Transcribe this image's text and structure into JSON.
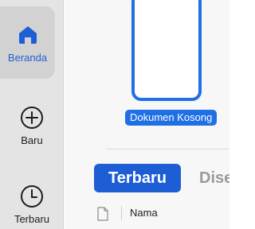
{
  "sidebar": {
    "items": [
      {
        "label": "Beranda",
        "icon": "home-icon",
        "active": true
      },
      {
        "label": "Baru",
        "icon": "plus-circle-icon",
        "active": false
      },
      {
        "label": "Terbaru",
        "icon": "clock-icon",
        "active": false
      }
    ]
  },
  "templates": {
    "blank_document_label": "Dokumen Kosong"
  },
  "tabs": {
    "active_label": "Terbaru",
    "inactive_label": "Dise"
  },
  "file_list": {
    "columns": [
      "Nama"
    ]
  },
  "colors": {
    "accent": "#1f6fe5",
    "sidebar_bg": "#e4e4e4",
    "active_item_bg": "#d2d2d2"
  }
}
